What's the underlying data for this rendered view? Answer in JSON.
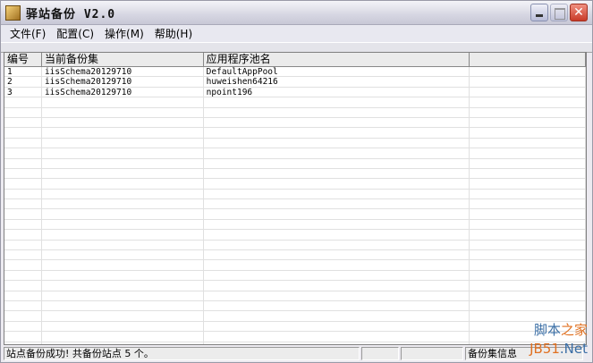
{
  "window": {
    "title": "驿站备份 V2.0",
    "close_glyph": "✕"
  },
  "menu": [
    "文件(F)",
    "配置(C)",
    "操作(M)",
    "帮助(H)"
  ],
  "table": {
    "columns": [
      "编号",
      "当前备份集",
      "应用程序池名",
      ""
    ],
    "rows": [
      [
        "1",
        "iisSchema20129710",
        "DefaultAppPool",
        ""
      ],
      [
        "2",
        "iisSchema20129710",
        "huweishen64216",
        ""
      ],
      [
        "3",
        "iisSchema20129710",
        "npoint196",
        ""
      ]
    ],
    "empty_rows": 26
  },
  "status": {
    "message": "站点备份成功! 共备份站点 5 个。",
    "panel2": "",
    "panel3": "",
    "panel4": "备份集信息"
  },
  "watermark": {
    "line1a": "脚本",
    "line1b": "之家",
    "line2a": "JB51",
    "line2b": ".Net"
  }
}
